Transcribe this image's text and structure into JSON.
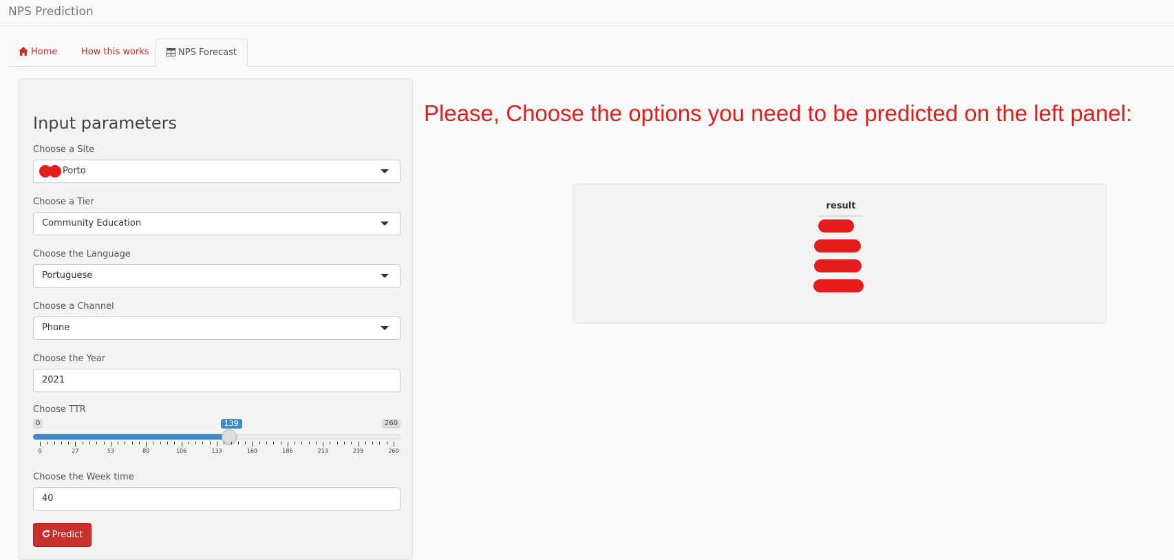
{
  "app": {
    "title": "NPS Prediction"
  },
  "tabs": [
    {
      "label": "Home",
      "icon": "home-icon"
    },
    {
      "label": "How this works"
    },
    {
      "label": "NPS Forecast",
      "icon": "table-icon"
    }
  ],
  "sidebar": {
    "title": "Input parameters",
    "site": {
      "label": "Choose a Site",
      "value": "Porto"
    },
    "tier": {
      "label": "Choose a Tier",
      "value": "Community Education"
    },
    "language": {
      "label": "Choose the Language",
      "value": "Portuguese"
    },
    "channel": {
      "label": "Choose a Channel",
      "value": "Phone"
    },
    "year": {
      "label": "Choose the Year",
      "value": "2021"
    },
    "ttr": {
      "label": "Choose TTR",
      "min": "0",
      "max": "260",
      "value": "139",
      "ticks": [
        "0",
        "27",
        "53",
        "80",
        "106",
        "133",
        "160",
        "186",
        "213",
        "239",
        "260"
      ]
    },
    "week": {
      "label": "Choose the Week time",
      "value": "40"
    },
    "predict_label": "Predict"
  },
  "main": {
    "headline": "Please, Choose the options you need to be predicted on the left panel:",
    "result_header": "result"
  },
  "colors": {
    "accent": "#c9302c",
    "headline": "#e51c1c",
    "slider": "#428bca"
  }
}
